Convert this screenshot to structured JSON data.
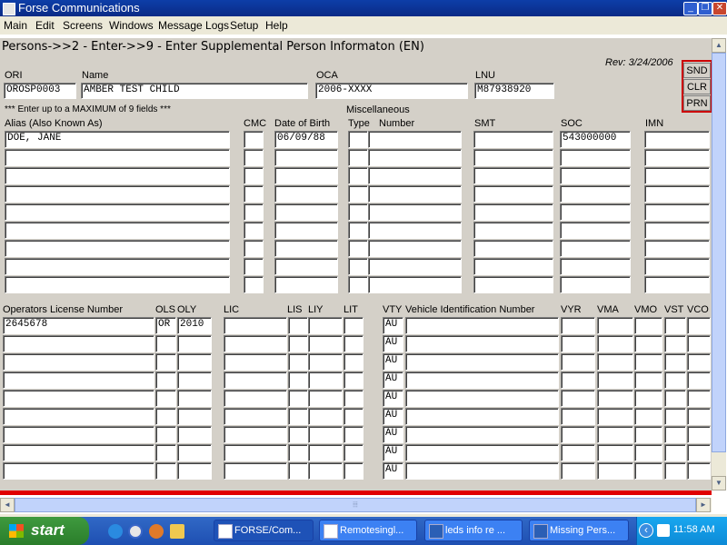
{
  "window": {
    "title": "Forse Communications",
    "controls": {
      "minimize": "_",
      "restore": "❐",
      "close": "✕"
    }
  },
  "menu": [
    "Main",
    "Edit",
    "Screens",
    "Windows",
    "Message Logs",
    "Setup",
    "Help"
  ],
  "screen": {
    "heading": "Persons->>2 - Enter->>9 - Enter Supplemental Person Informaton (EN)",
    "revision": "Rev: 3/24/2006",
    "buttons": {
      "send": "SND",
      "clear": "CLR",
      "print": "PRN"
    },
    "top_fields": {
      "ori_label": "ORI",
      "ori_value": "OROSP0003",
      "name_label": "Name",
      "name_value": "AMBER TEST CHILD",
      "oca_label": "OCA",
      "oca_value": "2006-XXXX",
      "lnu_label": "LNU",
      "lnu_value": "M87938920"
    },
    "max_note": "*** Enter up to a MAXIMUM of 9 fields ***",
    "misc_label": "Miscellaneous",
    "person_columns": {
      "alias": "Alias (Also Known As)",
      "cmc": "CMC",
      "dob": "Date of Birth",
      "type": "Type",
      "number": "Number",
      "smt": "SMT",
      "soc": "SOC",
      "imn": "IMN"
    },
    "person_rows": [
      {
        "alias": "DOE, JANE",
        "cmc": "",
        "dob": "06/09/88",
        "type": "",
        "number": "",
        "smt": "",
        "soc": "543000000",
        "imn": ""
      },
      {
        "alias": "",
        "cmc": "",
        "dob": "",
        "type": "",
        "number": "",
        "smt": "",
        "soc": "",
        "imn": ""
      },
      {
        "alias": "",
        "cmc": "",
        "dob": "",
        "type": "",
        "number": "",
        "smt": "",
        "soc": "",
        "imn": ""
      },
      {
        "alias": "",
        "cmc": "",
        "dob": "",
        "type": "",
        "number": "",
        "smt": "",
        "soc": "",
        "imn": ""
      },
      {
        "alias": "",
        "cmc": "",
        "dob": "",
        "type": "",
        "number": "",
        "smt": "",
        "soc": "",
        "imn": ""
      },
      {
        "alias": "",
        "cmc": "",
        "dob": "",
        "type": "",
        "number": "",
        "smt": "",
        "soc": "",
        "imn": ""
      },
      {
        "alias": "",
        "cmc": "",
        "dob": "",
        "type": "",
        "number": "",
        "smt": "",
        "soc": "",
        "imn": ""
      },
      {
        "alias": "",
        "cmc": "",
        "dob": "",
        "type": "",
        "number": "",
        "smt": "",
        "soc": "",
        "imn": ""
      },
      {
        "alias": "",
        "cmc": "",
        "dob": "",
        "type": "",
        "number": "",
        "smt": "",
        "soc": "",
        "imn": ""
      }
    ],
    "license_columns": {
      "oln": "Operators License Number",
      "ols": "OLS",
      "oly": "OLY",
      "lic": "LIC",
      "lis": "LIS",
      "liy": "LIY",
      "lit": "LIT",
      "vty": "VTY",
      "vin": "Vehicle Identification Number",
      "vyr": "VYR",
      "vma": "VMA",
      "vmo": "VMO",
      "vst": "VST",
      "vco": "VCO"
    },
    "license_rows": [
      {
        "oln": "2645678",
        "ols": "OR",
        "oly": "2010",
        "lic": "",
        "lis": "",
        "liy": "",
        "lit": "",
        "vty": "AU",
        "vin": "",
        "vyr": "",
        "vma": "",
        "vmo": "",
        "vst": "",
        "vco": ""
      },
      {
        "oln": "",
        "ols": "",
        "oly": "",
        "lic": "",
        "lis": "",
        "liy": "",
        "lit": "",
        "vty": "AU",
        "vin": "",
        "vyr": "",
        "vma": "",
        "vmo": "",
        "vst": "",
        "vco": ""
      },
      {
        "oln": "",
        "ols": "",
        "oly": "",
        "lic": "",
        "lis": "",
        "liy": "",
        "lit": "",
        "vty": "AU",
        "vin": "",
        "vyr": "",
        "vma": "",
        "vmo": "",
        "vst": "",
        "vco": ""
      },
      {
        "oln": "",
        "ols": "",
        "oly": "",
        "lic": "",
        "lis": "",
        "liy": "",
        "lit": "",
        "vty": "AU",
        "vin": "",
        "vyr": "",
        "vma": "",
        "vmo": "",
        "vst": "",
        "vco": ""
      },
      {
        "oln": "",
        "ols": "",
        "oly": "",
        "lic": "",
        "lis": "",
        "liy": "",
        "lit": "",
        "vty": "AU",
        "vin": "",
        "vyr": "",
        "vma": "",
        "vmo": "",
        "vst": "",
        "vco": ""
      },
      {
        "oln": "",
        "ols": "",
        "oly": "",
        "lic": "",
        "lis": "",
        "liy": "",
        "lit": "",
        "vty": "AU",
        "vin": "",
        "vyr": "",
        "vma": "",
        "vmo": "",
        "vst": "",
        "vco": ""
      },
      {
        "oln": "",
        "ols": "",
        "oly": "",
        "lic": "",
        "lis": "",
        "liy": "",
        "lit": "",
        "vty": "AU",
        "vin": "",
        "vyr": "",
        "vma": "",
        "vmo": "",
        "vst": "",
        "vco": ""
      },
      {
        "oln": "",
        "ols": "",
        "oly": "",
        "lic": "",
        "lis": "",
        "liy": "",
        "lit": "",
        "vty": "AU",
        "vin": "",
        "vyr": "",
        "vma": "",
        "vmo": "",
        "vst": "",
        "vco": ""
      },
      {
        "oln": "",
        "ols": "",
        "oly": "",
        "lic": "",
        "lis": "",
        "liy": "",
        "lit": "",
        "vty": "AU",
        "vin": "",
        "vyr": "",
        "vma": "",
        "vmo": "",
        "vst": "",
        "vco": ""
      }
    ]
  },
  "scrollbars": {
    "up": "▲",
    "down": "▼",
    "left": "◄",
    "right": "►",
    "grip": "⦙⦙⦙"
  },
  "taskbar": {
    "start_label": "start",
    "quick_launch": [
      "ie-icon",
      "media-player-icon",
      "firefox-icon",
      "folder-icon"
    ],
    "tasks": [
      {
        "label": "FORSE/Com...",
        "active": true
      },
      {
        "label": "Remotesingl...",
        "active": false
      },
      {
        "label": "leds info re ...",
        "active": false
      },
      {
        "label": "Missing Pers...",
        "active": false
      }
    ],
    "tray_arrow": "‹",
    "clock": "11:58 AM"
  }
}
